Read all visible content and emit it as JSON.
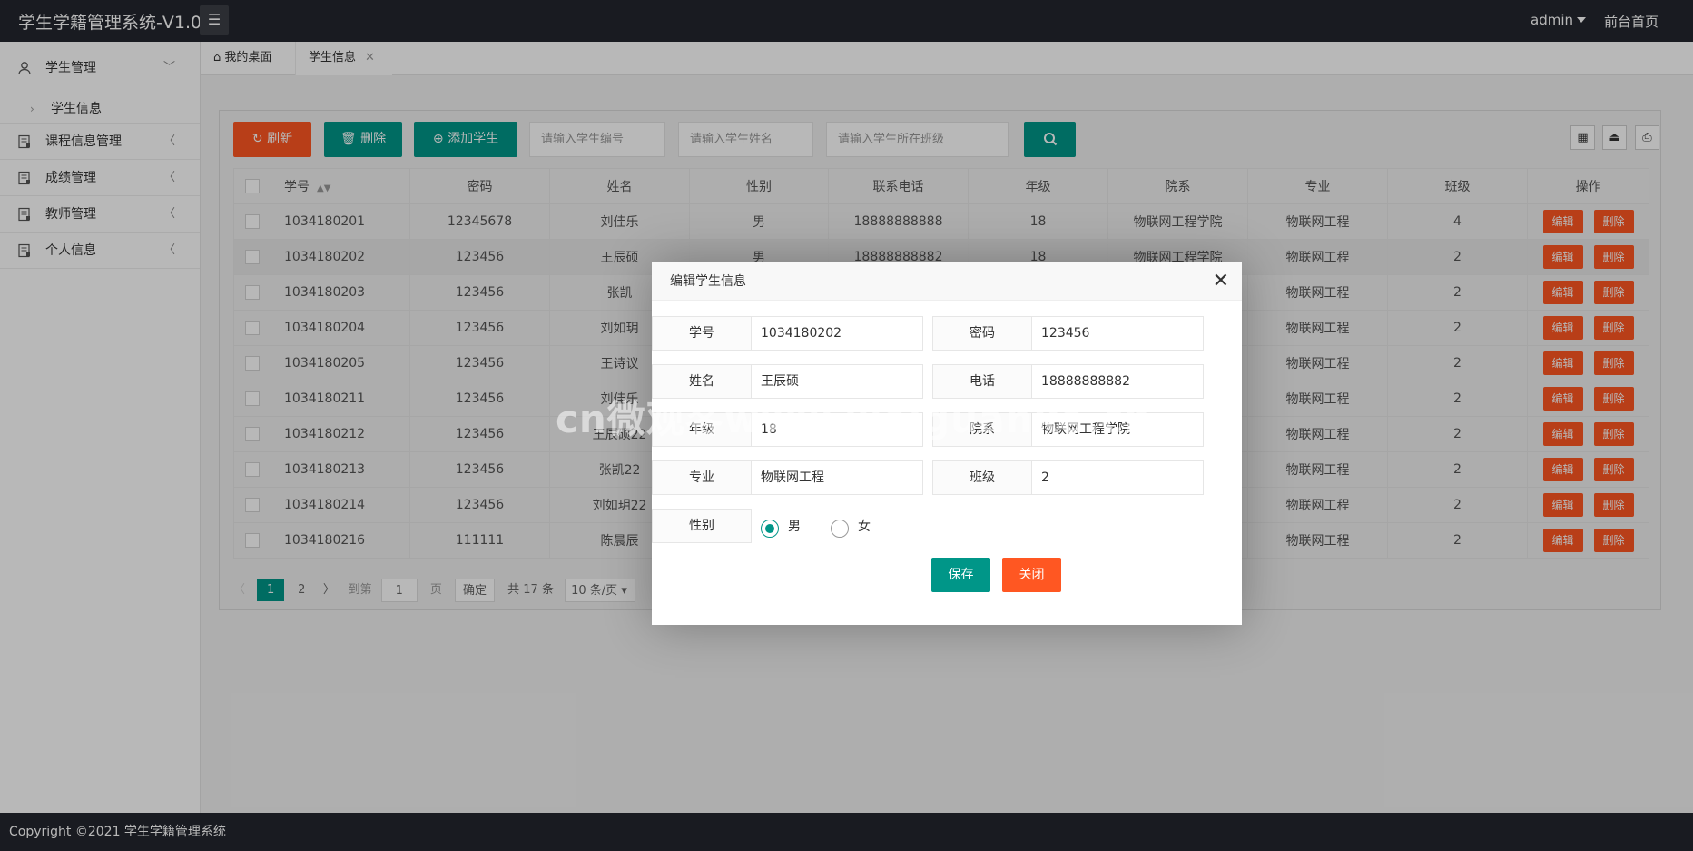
{
  "app": {
    "title": "学生学籍管理系统-V1.0",
    "menu_icon": "menu-icon"
  },
  "header": {
    "user": "admin",
    "front_link": "前台首页"
  },
  "sidebar": {
    "items": [
      {
        "label": "学生管理",
        "icon": "user-icon",
        "arrow": "﹀"
      },
      {
        "label": "课程信息管理",
        "icon": "note-icon",
        "arrow": "〈"
      },
      {
        "label": "成绩管理",
        "icon": "note-icon",
        "arrow": "〈"
      },
      {
        "label": "教师管理",
        "icon": "note-icon",
        "arrow": "〈"
      },
      {
        "label": "个人信息",
        "icon": "note-icon",
        "arrow": "〈"
      }
    ],
    "sub_items": [
      {
        "label": "学生信息"
      }
    ]
  },
  "tabs": {
    "home": "我的桌面",
    "active": "学生信息"
  },
  "toolbar": {
    "refresh": "刷新",
    "delete": "删除",
    "add": "添加学生",
    "search_id_placeholder": "请输入学生编号",
    "search_name_placeholder": "请输入学生姓名",
    "search_class_placeholder": "请输入学生所在班级"
  },
  "table": {
    "headers": [
      "学号",
      "密码",
      "姓名",
      "性别",
      "联系电话",
      "年级",
      "院系",
      "专业",
      "班级",
      "操作"
    ],
    "edit_label": "编辑",
    "delete_label": "删除",
    "rows": [
      [
        "1034180201",
        "12345678",
        "刘佳乐",
        "男",
        "18888888888",
        "18",
        "物联网工程学院",
        "物联网工程",
        "4"
      ],
      [
        "1034180202",
        "123456",
        "王辰硕",
        "男",
        "18888888882",
        "18",
        "物联网工程学院",
        "物联网工程",
        "2"
      ],
      [
        "1034180203",
        "123456",
        "张凯",
        "",
        "",
        "",
        "",
        "物联网工程",
        "2"
      ],
      [
        "1034180204",
        "123456",
        "刘如玥",
        "",
        "",
        "",
        "",
        "物联网工程",
        "2"
      ],
      [
        "1034180205",
        "123456",
        "王诗议",
        "",
        "",
        "",
        "",
        "物联网工程",
        "2"
      ],
      [
        "1034180211",
        "123456",
        "刘佳乐",
        "",
        "",
        "",
        "",
        "物联网工程",
        "2"
      ],
      [
        "1034180212",
        "123456",
        "王辰硕22",
        "",
        "",
        "",
        "",
        "物联网工程",
        "2"
      ],
      [
        "1034180213",
        "123456",
        "张凯22",
        "",
        "",
        "",
        "",
        "物联网工程",
        "2"
      ],
      [
        "1034180214",
        "123456",
        "刘如玥22",
        "",
        "",
        "",
        "",
        "物联网工程",
        "2"
      ],
      [
        "1034180216",
        "111111",
        "陈晨辰",
        "",
        "",
        "",
        "",
        "物联网工程",
        "2"
      ]
    ]
  },
  "pager": {
    "current": "1",
    "page2": "2",
    "goto": "到第",
    "page_input": "1",
    "page_unit": "页",
    "confirm": "确定",
    "total": "共 17 条",
    "per_page": "10 条/页"
  },
  "modal": {
    "title": "编辑学生信息",
    "fields": {
      "id_label": "学号",
      "id_value": "1034180202",
      "pwd_label": "密码",
      "pwd_value": "123456",
      "name_label": "姓名",
      "name_value": "王辰硕",
      "phone_label": "电话",
      "phone_value": "18888888882",
      "grade_label": "年级",
      "grade_value": "18",
      "dept_label": "院系",
      "dept_value": "物联网工程学院",
      "major_label": "专业",
      "major_value": "物联网工程",
      "class_label": "班级",
      "class_value": "2",
      "gender_label": "性别",
      "male": "男",
      "female": "女",
      "selected": "男"
    },
    "save": "保存",
    "close": "关闭"
  },
  "watermark": "cn微观客www.weiguanke.cn",
  "footer": {
    "copyright": "Copyright ©2021 学生学籍管理系统"
  },
  "colors": {
    "teal": "#009688",
    "orange": "#ff5722",
    "dark": "#23262e"
  }
}
